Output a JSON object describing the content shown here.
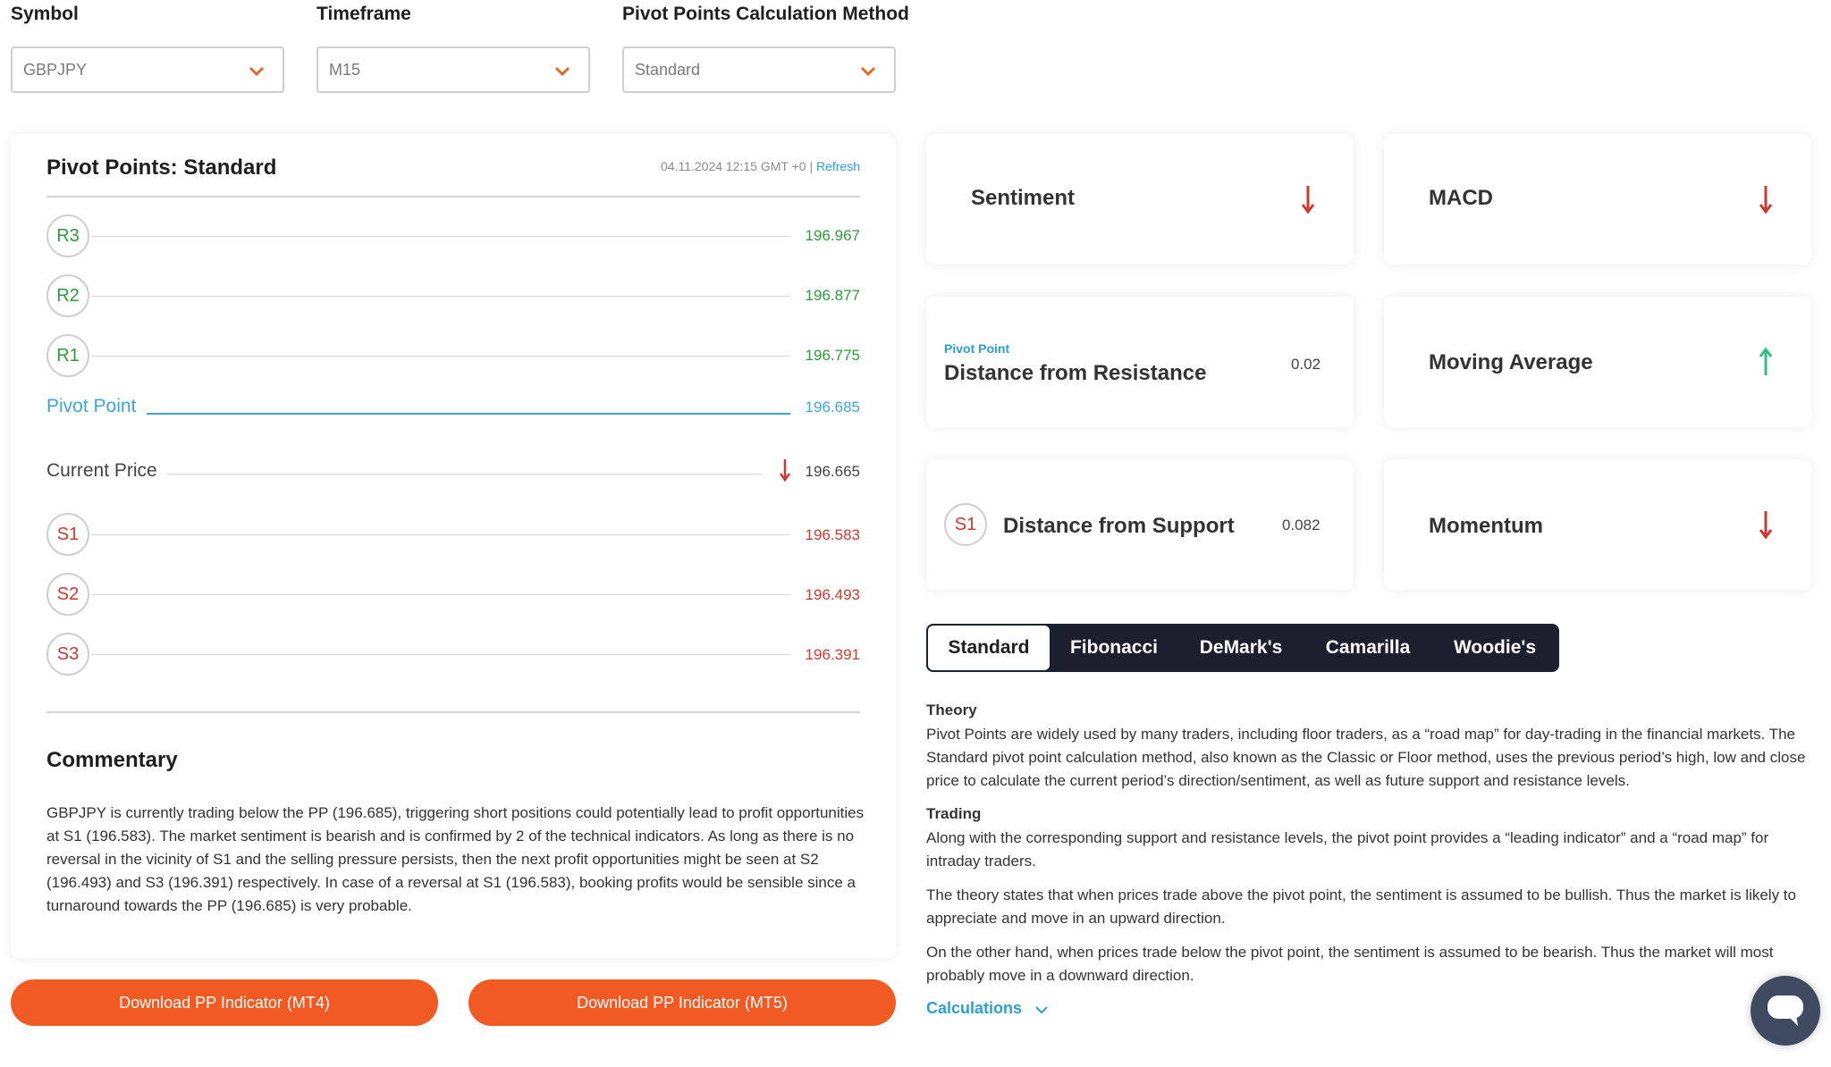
{
  "filters": {
    "symbol_label": "Symbol",
    "symbol_value": "GBPJPY",
    "timeframe_label": "Timeframe",
    "timeframe_value": "M15",
    "method_label": "Pivot Points Calculation Method",
    "method_value": "Standard"
  },
  "pivot": {
    "title": "Pivot Points: Standard",
    "timestamp": "04.11.2024 12:15 GMT +0",
    "separator": "|",
    "refresh_label": "Refresh",
    "levels": [
      {
        "name": "R3",
        "value": "196.967"
      },
      {
        "name": "R2",
        "value": "196.877"
      },
      {
        "name": "R1",
        "value": "196.775"
      },
      {
        "name": "Pivot Point",
        "value": "196.685"
      },
      {
        "name": "Current Price",
        "value": "196.665"
      },
      {
        "name": "S1",
        "value": "196.583"
      },
      {
        "name": "S2",
        "value": "196.493"
      },
      {
        "name": "S3",
        "value": "196.391"
      }
    ]
  },
  "commentary": {
    "title": "Commentary",
    "text": "GBPJPY is currently trading below the PP (196.685), triggering short positions could potentially lead to profit opportunities at S1 (196.583). The market sentiment is bearish and is confirmed by 2 of the technical indicators. As long as there is no reversal in the vicinity of S1 and the selling pressure persists, then the next profit opportunities might be seen at S2 (196.493) and S3 (196.391) respectively. In case of a reversal at S1 (196.583), booking profits would be sensible since a turnaround towards the PP (196.685) is very probable."
  },
  "downloads": {
    "mt4": "Download PP Indicator (MT4)",
    "mt5": "Download PP Indicator (MT5)"
  },
  "indicators": {
    "sentiment": "Sentiment",
    "macd": "MACD",
    "resistance_small": "Pivot Point",
    "resistance_title": "Distance from Resistance",
    "resistance_value": "0.02",
    "moving_average": "Moving Average",
    "support_badge": "S1",
    "support_title": "Distance from Support",
    "support_value": "0.082",
    "momentum": "Momentum"
  },
  "method_tabs": [
    "Standard",
    "Fibonacci",
    "DeMark's",
    "Camarilla",
    "Woodie's"
  ],
  "theory": {
    "theory_title": "Theory",
    "theory_text": "Pivot Points are widely used by many traders, including floor traders, as a “road map” for day-trading in the financial markets. The Standard pivot point calculation method, also known as the Classic or Floor method, uses the previous period’s high, low and close price to calculate the current period’s direction/sentiment, as well as future support and resistance levels.",
    "trading_title": "Trading",
    "trading_text_1": "Along with the corresponding support and resistance levels, the pivot point provides a “leading indicator” and a “road map” for intraday traders.",
    "trading_text_2": "The theory states that when prices trade above the pivot point, the sentiment is assumed to be bullish. Thus the market is likely to appreciate and move in an upward direction.",
    "trading_text_3": "On the other hand, when prices trade below the pivot point, the sentiment is assumed to be bearish. Thus the market will most probably move in a downward direction.",
    "calculations_label": "Calculations"
  },
  "colors": {
    "accent_orange": "#f25a23",
    "bull_green": "#2a9d3a",
    "bear_red": "#d1382f",
    "link_blue": "#2a9fd6",
    "tab_dark": "#1c1f2e"
  }
}
